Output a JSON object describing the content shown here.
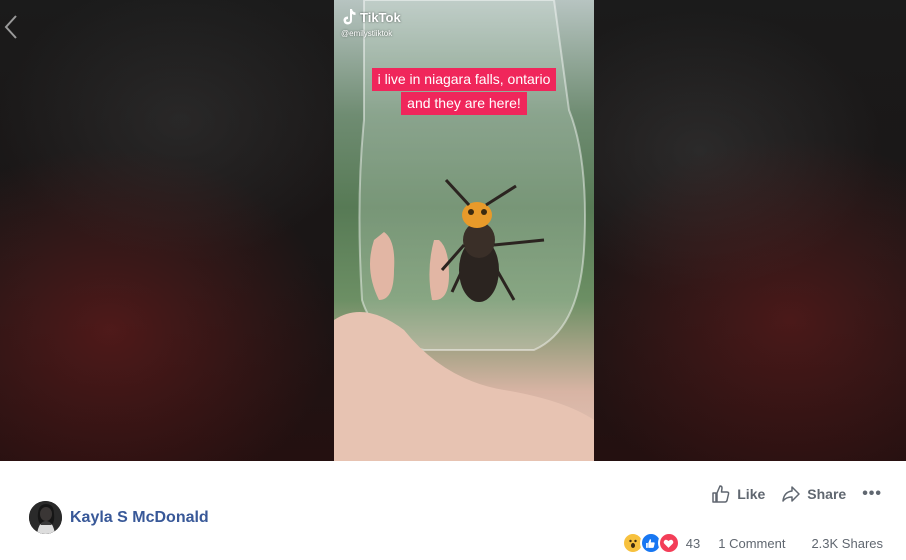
{
  "video": {
    "app_name": "TikTok",
    "handle": "@emilystiiktok",
    "caption_line1": "i live in niagara falls, ontario",
    "caption_line2": "and they are here!"
  },
  "post": {
    "author_name": "Kayla S McDonald",
    "like_label": "Like",
    "share_label": "Share",
    "more_label": "•••",
    "reaction_count": "43",
    "comments_label": "1 Comment",
    "shares_label": "2.3K Shares",
    "reactions": [
      "wow-icon",
      "like-icon",
      "love-icon"
    ]
  },
  "colors": {
    "author_link": "#385898",
    "caption_bg": "#f0265b",
    "muted_text": "#606770",
    "like_blue": "#1877f2",
    "love_red": "#f33e58",
    "wow_yellow": "#f7c13e"
  }
}
